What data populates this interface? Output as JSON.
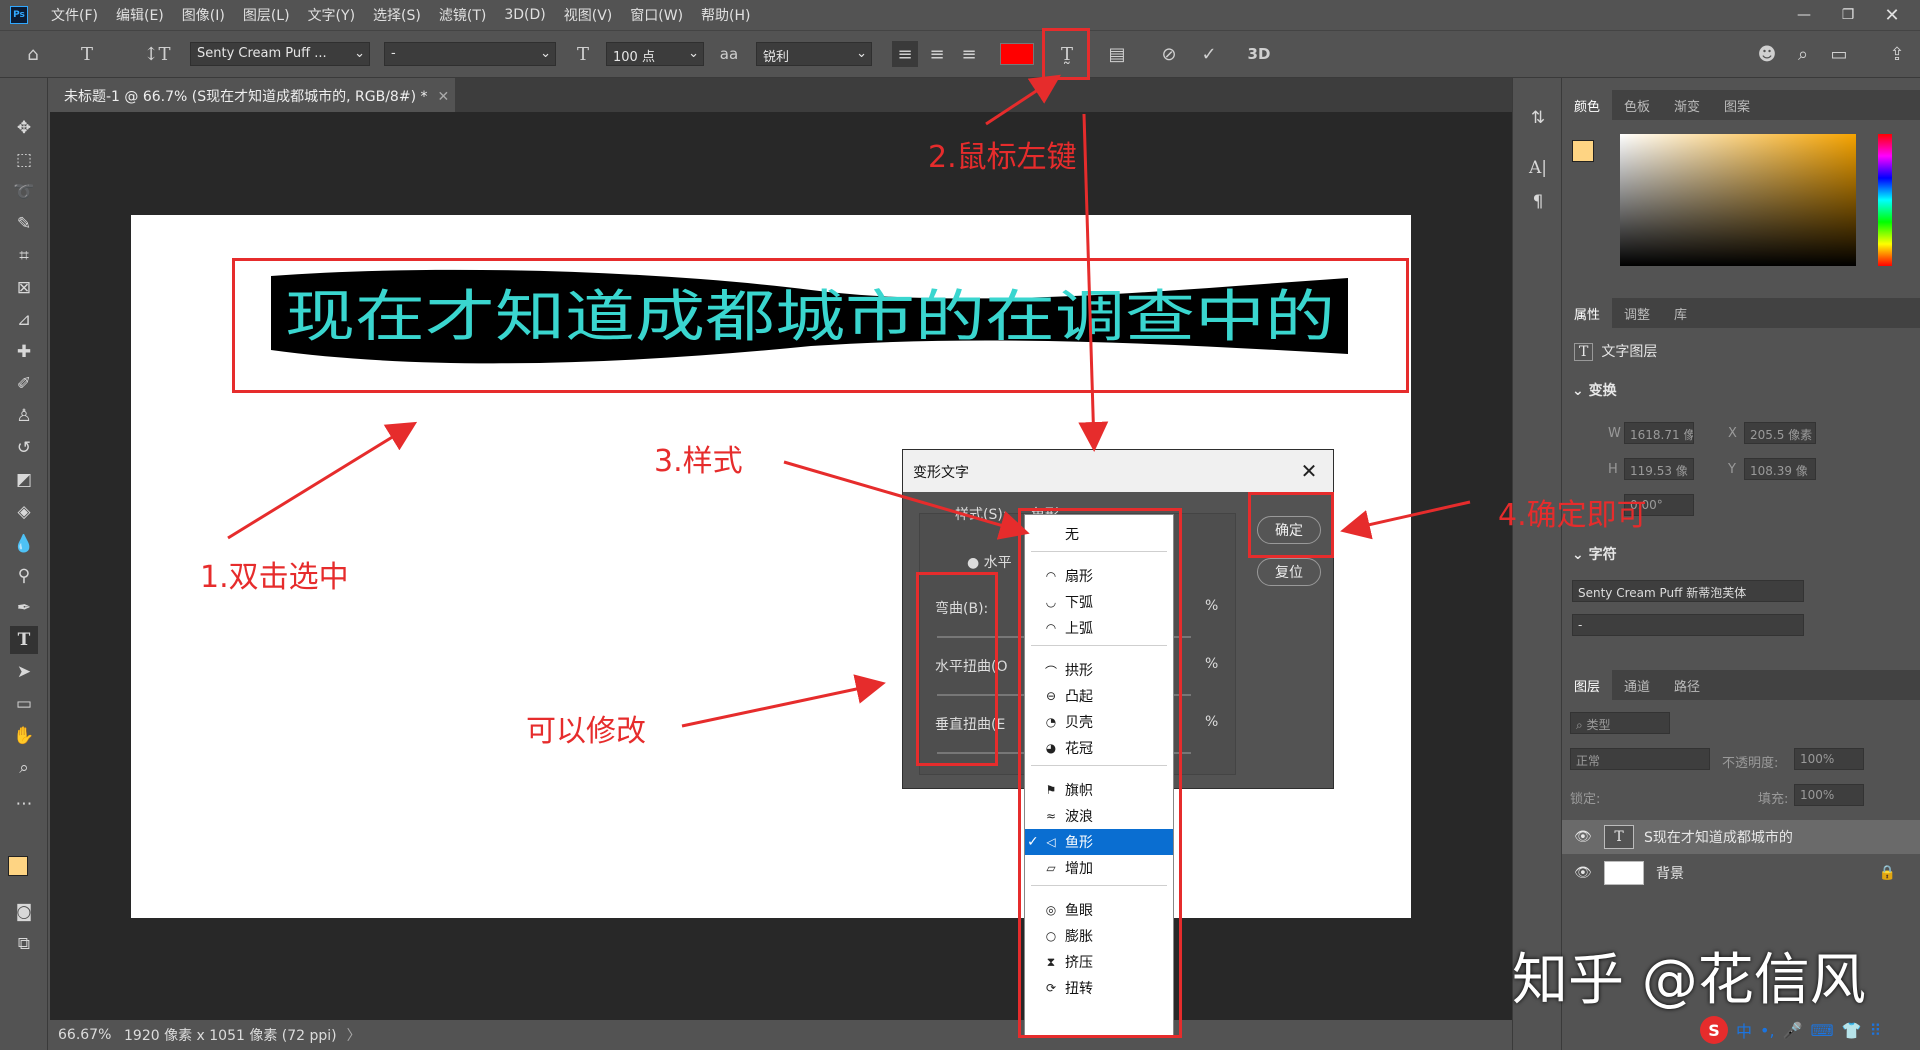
{
  "app": {
    "logo": "Ps"
  },
  "menu": [
    "文件(F)",
    "编辑(E)",
    "图像(I)",
    "图层(L)",
    "文字(Y)",
    "选择(S)",
    "滤镜(T)",
    "3D(D)",
    "视图(V)",
    "窗口(W)",
    "帮助(H)"
  ],
  "options": {
    "font_family": "Senty Cream Puff ...",
    "font_style": "-",
    "font_size": "100 点",
    "aa_label": "aa",
    "antialias": "锐利",
    "text_color": "#ff0000",
    "td_label": "3D"
  },
  "document": {
    "tab_title": "未标题-1 @ 66.7% (S现在才知道成都城市的, RGB/8#) *",
    "canvas_text": "现在才知道成都城市的在调查中的"
  },
  "status": {
    "zoom": "66.67%",
    "info": "1920 像素 x 1051 像素 (72 ppi)",
    "arrow": "〉"
  },
  "panels": {
    "color_tabs": [
      "颜色",
      "色板",
      "渐变",
      "图案"
    ],
    "props_tabs": [
      "属性",
      "调整",
      "库"
    ],
    "text_layer_label": "文字图层",
    "transform_header": "变换",
    "w_label": "W",
    "w_value": "1618.71 像",
    "x_label": "X",
    "x_value": "205.5 像素",
    "h_label": "H",
    "h_value": "119.53 像",
    "y_label": "Y",
    "y_value": "108.39 像",
    "angle_value": "0.00°",
    "char_header": "字符",
    "char_font": "Senty Cream Puff 新蒂泡芙体",
    "char_style": "-",
    "layers_tabs": [
      "图层",
      "通道",
      "路径"
    ],
    "layer_filter": "类型",
    "blend_mode": "正常",
    "opacity_label": "不透明度:",
    "opacity_value": "100%",
    "lock_label": "锁定:",
    "fill_label": "填充:",
    "fill_value": "100%",
    "layers": [
      {
        "name": "S现在才知道成都城市的",
        "thumb": "T"
      },
      {
        "name": "背景",
        "thumb": ""
      }
    ]
  },
  "dialog": {
    "title": "变形文字",
    "style_label": "样式(S):",
    "style_value": "鱼形",
    "horizontal_label": "水平",
    "bend_label": "弯曲(B):",
    "hdist_label": "水平扭曲(O",
    "vdist_label": "垂直扭曲(E",
    "pct": "%",
    "ok": "确定",
    "reset": "复位"
  },
  "dropdown": {
    "items": [
      {
        "label": "无",
        "icon": ""
      },
      {
        "label": "扇形",
        "icon": "◠"
      },
      {
        "label": "下弧",
        "icon": "◡"
      },
      {
        "label": "上弧",
        "icon": "◠"
      },
      {
        "label": "拱形",
        "icon": "⌒"
      },
      {
        "label": "凸起",
        "icon": "⊖"
      },
      {
        "label": "贝壳",
        "icon": "◔"
      },
      {
        "label": "花冠",
        "icon": "◕"
      },
      {
        "label": "旗帜",
        "icon": "⚑"
      },
      {
        "label": "波浪",
        "icon": "≈"
      },
      {
        "label": "鱼形",
        "icon": "◁"
      },
      {
        "label": "增加",
        "icon": "▱"
      },
      {
        "label": "鱼眼",
        "icon": "◎"
      },
      {
        "label": "膨胀",
        "icon": "○"
      },
      {
        "label": "挤压",
        "icon": "⧗"
      },
      {
        "label": "扭转",
        "icon": "⟳"
      }
    ],
    "selected": "鱼形"
  },
  "annotations": {
    "a1": "1.双击选中",
    "a2": "2.鼠标左键",
    "a3": "3.样式",
    "a4": "4.确定即可",
    "a5": "可以修改",
    "color": "#e62c2c"
  },
  "watermark": "知乎 @花信风",
  "ime": {
    "logo": "S",
    "lang": "中"
  }
}
